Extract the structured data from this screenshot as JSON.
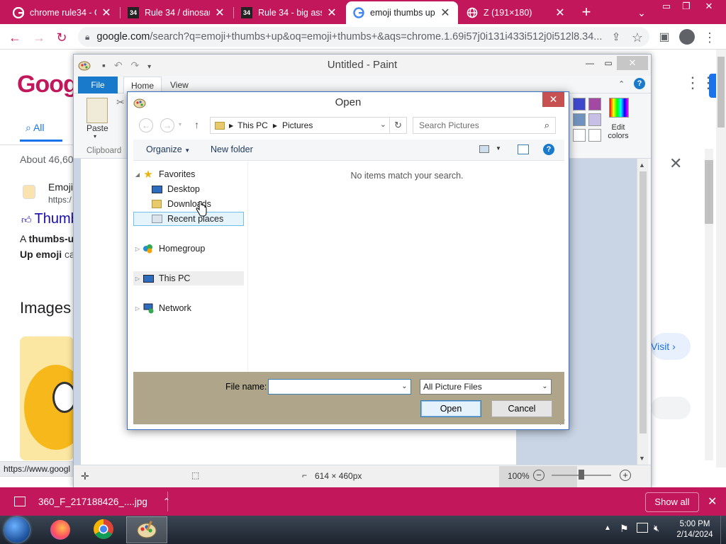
{
  "chrome": {
    "tabs": [
      {
        "label": "chrome rule34 - G"
      },
      {
        "label": "Rule 34 / dinosau"
      },
      {
        "label": "Rule 34 - big ass"
      },
      {
        "label": "emoji thumbs up"
      },
      {
        "label": "Z (191×180)"
      }
    ],
    "omnibox": {
      "host": "google.com",
      "path": "/search?q=emoji+thumbs+up&oq=emoji+thumbs+&aqs=chrome.1.69i57j0i131i433i512j0i512l8.34..."
    },
    "colors": {
      "accent": "#c2185b",
      "tab_active": "#ffffff"
    }
  },
  "google_page": {
    "tab_all": "All",
    "result_count": "About 46,60",
    "result_site": "Emoji",
    "result_url": "https:/",
    "result_title": "Thumb",
    "snippet_line1_prefix": "A ",
    "snippet_line1_bold": "thumbs-u",
    "snippet_line2_bold": "Up emoji",
    "snippet_line2_rest": " ca",
    "images_heading": "Images",
    "visit_label": "Visit",
    "status_url": "https://www.googl"
  },
  "paint": {
    "title": "Untitled - Paint",
    "ribbon_tabs": [
      "File",
      "Home",
      "View"
    ],
    "clipboard_group": "Clipboard",
    "paste_label": "Paste",
    "edit_colors_label": "Edit\ncolors",
    "status": {
      "dimensions": "614 × 460px",
      "zoom": "100%"
    }
  },
  "open_dialog": {
    "title": "Open",
    "breadcrumb": [
      "This PC",
      "Pictures"
    ],
    "search_placeholder": "Search Pictures",
    "commands": {
      "organize": "Organize",
      "new_folder": "New folder"
    },
    "tree": {
      "favorites": "Favorites",
      "desktop": "Desktop",
      "downloads": "Downloads",
      "recent_places": "Recent places",
      "homegroup": "Homegroup",
      "this_pc": "This PC",
      "network": "Network"
    },
    "empty_message": "No items match your search.",
    "file_name_label": "File name:",
    "file_name_value": "",
    "file_type": "All Picture Files",
    "open_button": "Open",
    "cancel_button": "Cancel"
  },
  "download_bar": {
    "file_name": "360_F_217188426_....jpg",
    "show_all": "Show all"
  },
  "taskbar": {
    "time": "5:00 PM",
    "date": "2/14/2024"
  }
}
